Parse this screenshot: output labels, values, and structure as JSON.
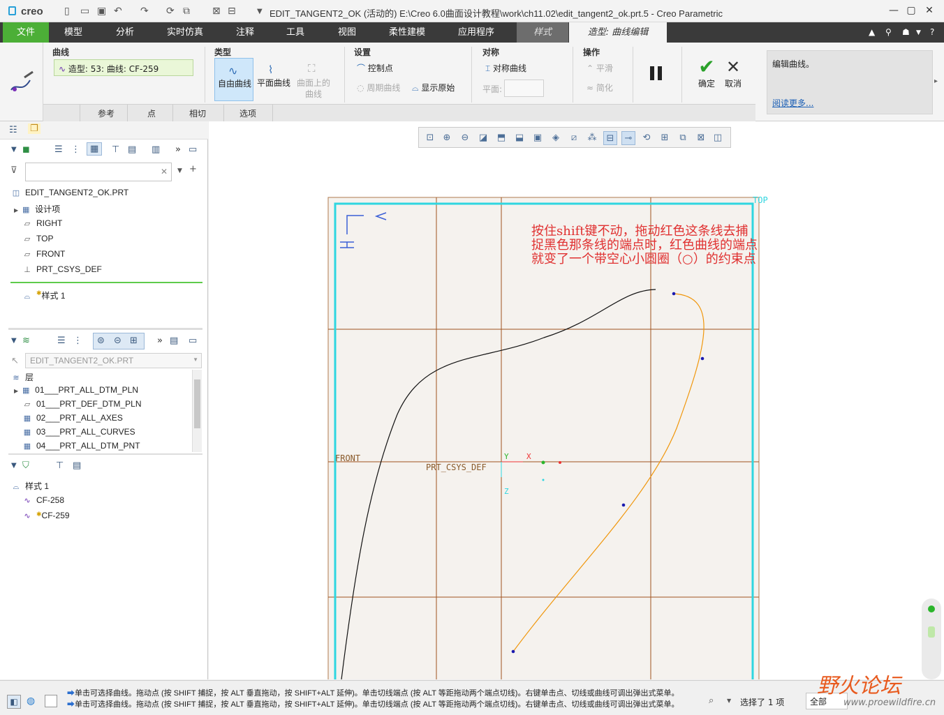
{
  "titlebar": {
    "logo": "creo",
    "title": "EDIT_TANGENT2_OK (活动的) E:\\Creo 6.0曲面设计教程\\work\\ch11.02\\edit_tangent2_ok.prt.5 - Creo Parametric"
  },
  "menu": {
    "tabs": [
      "文件",
      "模型",
      "分析",
      "实时仿真",
      "注释",
      "工具",
      "视图",
      "柔性建模",
      "应用程序",
      "样式",
      "造型: 曲线编辑"
    ]
  },
  "ribbon": {
    "curve_group": "曲线",
    "curve_value": "造型: 53: 曲线: CF-259",
    "type_group": "类型",
    "type_free": "自由曲线",
    "type_planar": "平面曲线",
    "type_cos_1": "曲面上的",
    "type_cos_2": "曲线",
    "settings_group": "设置",
    "control_point": "控制点",
    "periodic": "周期曲线",
    "show_original": "显示原始",
    "symmetry_group": "对称",
    "symmetric_curve": "对称曲线",
    "plane_label": "平面:",
    "ops_group": "操作",
    "smooth": "平滑",
    "simplify": "简化",
    "ok": "确定",
    "cancel": "取消",
    "help_text": "编辑曲线。",
    "help_link": "阅读更多...",
    "subtabs": [
      "参考",
      "点",
      "相切",
      "选项"
    ]
  },
  "model_tree": {
    "root": "EDIT_TANGENT2_OK.PRT",
    "items": [
      "设计项",
      "RIGHT",
      "TOP",
      "FRONT",
      "PRT_CSYS_DEF"
    ],
    "inserted": "样式 1"
  },
  "layer_tree": {
    "dropdown": "EDIT_TANGENT2_OK.PRT",
    "header": "层",
    "items": [
      "01___PRT_ALL_DTM_PLN",
      "01___PRT_DEF_DTM_PLN",
      "02___PRT_ALL_AXES",
      "03___PRT_ALL_CURVES",
      "04___PRT_ALL_DTM_PNT"
    ]
  },
  "style_tree": {
    "root": "样式 1",
    "items": [
      "CF-258",
      "CF-259"
    ]
  },
  "graphics": {
    "plane_top": "TOP",
    "plane_front": "FRONT",
    "csys": "PRT_CSYS_DEF",
    "axis_y": "Y",
    "axis_x": "X",
    "axis_z": "Z",
    "annotation": [
      "按住shift键不动，拖动红色这条线去捕",
      "捉黑色那条线的端点时，红色曲线的端点",
      "就变了一个带空心小圆圈（○）的约束点"
    ]
  },
  "status": {
    "msg1": "单击可选择曲线。拖动点 (按 SHIFT 捕捉，按 ALT 垂直拖动，按 SHIFT+ALT 延伸)。单击切线端点 (按 ALT 等距拖动两个端点切线)。右键单击点、切线或曲线可调出弹出式菜单。",
    "msg2": "单击可选择曲线。拖动点 (按 SHIFT 捕捉，按 ALT 垂直拖动，按 SHIFT+ALT 延伸)。单击切线端点 (按 ALT 等距拖动两个端点切线)。右键单击点、切线或曲线可调出弹出式菜单。",
    "selection": "选择了 1 项",
    "filter": "全部"
  },
  "watermark": {
    "brand": "野火论坛",
    "url": "www.proewildfire.cn"
  },
  "colors": {
    "menubar": "#3a3a3a",
    "file_tab": "#4caf37",
    "datum_plane": "#2fd6e0",
    "grid": "#a0531e",
    "red_curve": "#f0960a",
    "annotation": "#e03030"
  }
}
